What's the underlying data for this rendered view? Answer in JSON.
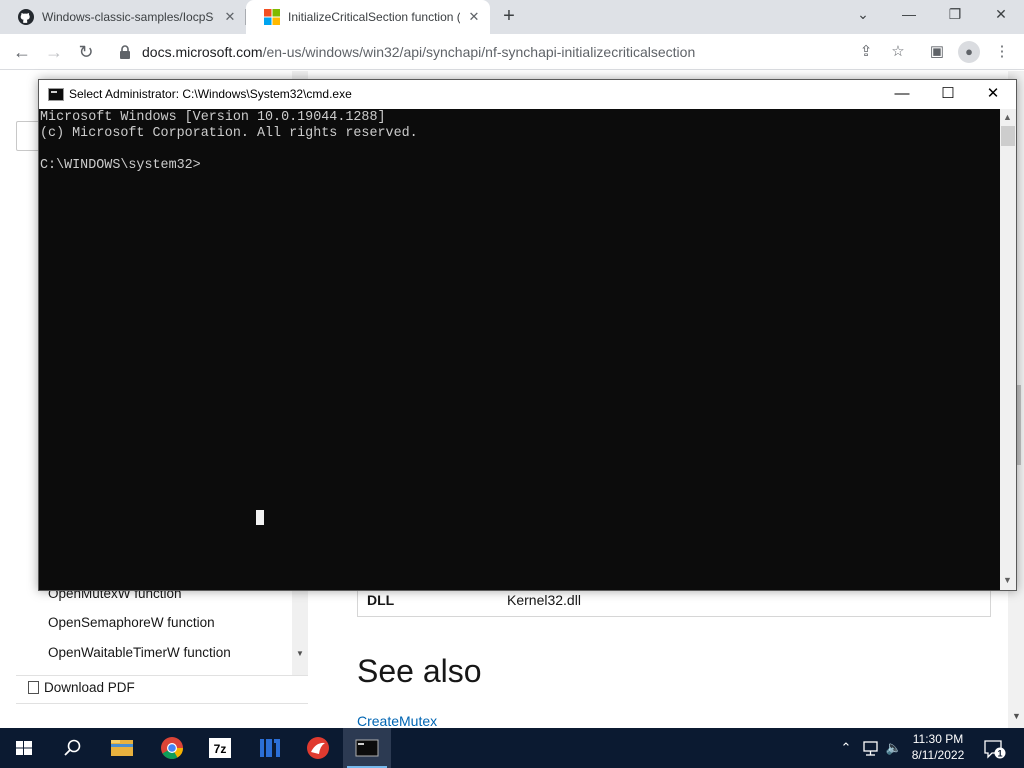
{
  "browser": {
    "tabs": [
      {
        "title": "Windows-classic-samples/IocpSe",
        "icon": "github-icon",
        "active": false
      },
      {
        "title": "InitializeCriticalSection function (",
        "icon": "microsoft-logo-icon",
        "active": true
      }
    ],
    "new_tab_label": "+",
    "window_controls": {
      "chevron": "⌄",
      "minimize": "—",
      "restore": "❐",
      "close": "✕"
    },
    "url_host": "docs.microsoft.com",
    "url_path": "/en-us/windows/win32/api/synchapi/nf-synchapi-initializecriticalsection"
  },
  "docs_page": {
    "toc_items": [
      "OpenMutexW function",
      "OpenSemaphoreW function",
      "OpenWaitableTimerW function"
    ],
    "download_pdf": "Download PDF",
    "requirements_row": {
      "key": "DLL",
      "value": "Kernel32.dll"
    },
    "see_also_heading": "See also",
    "see_also_link": "CreateMutex"
  },
  "cmd_window": {
    "title": "Select Administrator: C:\\Windows\\System32\\cmd.exe",
    "lines": [
      "Microsoft Windows [Version 10.0.19044.1288]",
      "(c) Microsoft Corporation. All rights reserved.",
      "",
      "C:\\WINDOWS\\system32>"
    ],
    "controls": {
      "minimize": "—",
      "maximize": "☐",
      "close": "✕"
    }
  },
  "taskbar": {
    "apps": [
      "start-icon",
      "search-icon",
      "file-explorer-icon",
      "chrome-icon",
      "7zip-icon",
      "ida-icon",
      "app-red-icon",
      "cmd-icon"
    ],
    "active_app": "cmd-icon",
    "clock_time": "11:30 PM",
    "clock_date": "8/11/2022",
    "notification_count": "1"
  },
  "colors": {
    "console_bg": "#0c0c0c",
    "console_text": "#cccccc",
    "taskbar_bg": "#0b1a31",
    "link": "#0065b3"
  }
}
